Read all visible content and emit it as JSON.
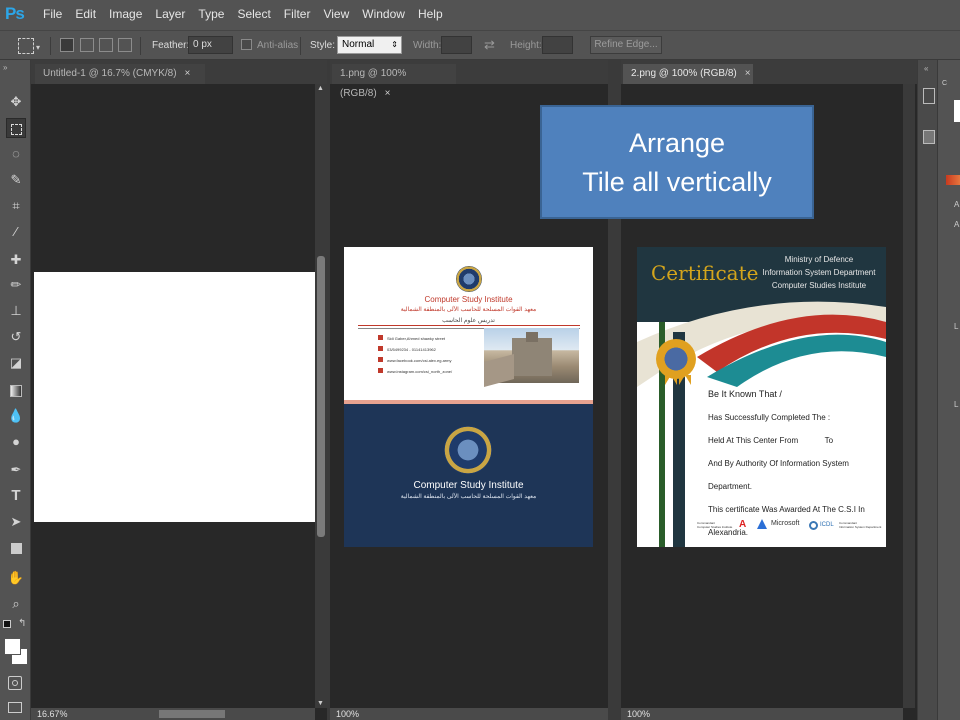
{
  "app": {
    "logo": "Ps"
  },
  "menu": [
    "File",
    "Edit",
    "Image",
    "Layer",
    "Type",
    "Select",
    "Filter",
    "View",
    "Window",
    "Help"
  ],
  "options": {
    "feather_label": "Feather:",
    "feather_value": "0 px",
    "antialias_label": "Anti-alias",
    "style_label": "Style:",
    "style_value": "Normal",
    "width_label": "Width:",
    "height_label": "Height:",
    "refine_label": "Refine Edge..."
  },
  "tabs": [
    {
      "title": "Untitled-1 @ 16.7% (CMYK/8)",
      "close": "×"
    },
    {
      "title": "1.png @ 100% (RGB/8)",
      "close": "×"
    },
    {
      "title": "2.png @ 100% (RGB/8)",
      "close": "×"
    }
  ],
  "status": [
    "16.67%",
    "100%",
    "100%"
  ],
  "callout": {
    "line1": "Arrange",
    "line2": "Tile all vertically"
  },
  "card1": {
    "title": "Computer Study Institute",
    "arabic1": "معهد القوات المسلحة للحاسب الآلى بالمنطقة الشمالية",
    "arabic2": "تدريس علوم الحاسب",
    "contacts": [
      "Sidi Gaber,Ahmed shawky street",
      "03/5499234 - 01141413962",
      "www.facebook.com/csi.alex.eg.army",
      "www.instagram.com/csi_north_zone/"
    ],
    "bottom_title": "Computer Study Institute",
    "bottom_arabic": "معهد القوات المسلحة للحاسب الآلى بالمنطقة الشمالية"
  },
  "cert": {
    "title": "Certificate",
    "org1": "Ministry of Defence",
    "org2": "Information System Department",
    "org3": "Computer Studies Institute",
    "lines": [
      "Be It Known That /",
      "Has Successfully Completed The :",
      "Held At This Center From            To",
      "And By Authority Of Information System Department.",
      "This certificate Was Awarded At The C.S.I In Alexandria.",
      "At"
    ],
    "sign_left": "Commandant\nComputer Studies Institute",
    "sign_right": "Commandant\nInformation System Department",
    "logos": [
      "Microsoft",
      "ICDL"
    ]
  },
  "colors": {
    "callout": "#4f81bd",
    "cert_title": "#d4a51c",
    "card_navy": "#1e3557"
  }
}
